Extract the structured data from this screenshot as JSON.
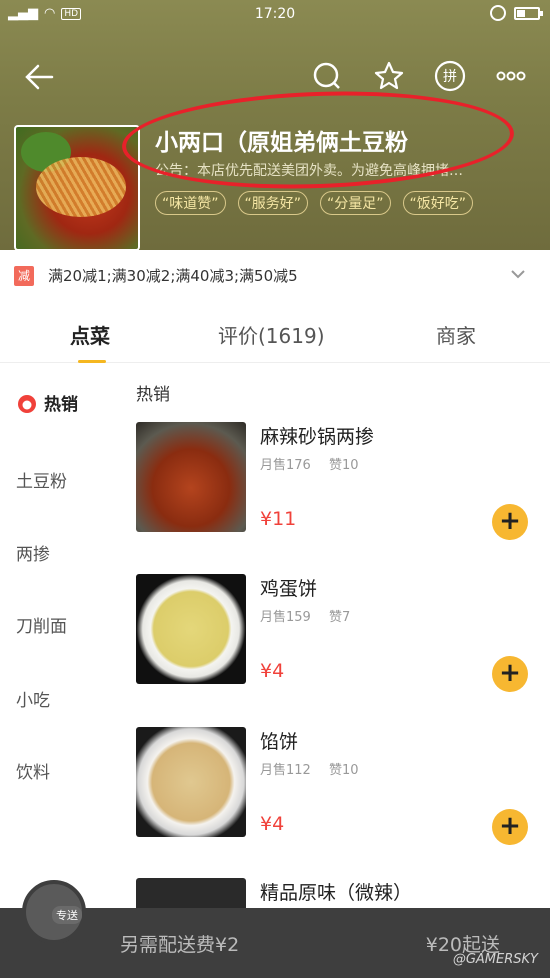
{
  "status_bar": {
    "signal": "all",
    "hd": "HD",
    "time": "17:20"
  },
  "shop": {
    "title": "小两口（原姐弟俩土豆粉",
    "notice": "公告：本店优先配送美团外卖。为避免高峰拥堵…",
    "tags": [
      "“味道赞”",
      "“服务好”",
      "“分量足”",
      "“饭好吃”"
    ]
  },
  "promo": {
    "badge": "减",
    "text": "满20减1;满30减2;满40减3;满50减5"
  },
  "tabs": [
    {
      "label": "点菜"
    },
    {
      "label": "评价(1619)"
    },
    {
      "label": "商家"
    }
  ],
  "sidebar": {
    "items": [
      {
        "label": "热销"
      },
      {
        "label": "土豆粉"
      },
      {
        "label": "两掺"
      },
      {
        "label": "刀削面"
      },
      {
        "label": "小吃"
      },
      {
        "label": "饮料"
      }
    ]
  },
  "menu": {
    "section_title": "热销",
    "items": [
      {
        "name": "麻辣砂锅两掺",
        "sold": "月售176",
        "likes": "赞10",
        "price": "¥11"
      },
      {
        "name": "鸡蛋饼",
        "sold": "月售159",
        "likes": "赞7",
        "price": "¥4"
      },
      {
        "name": "馅饼",
        "sold": "月售112",
        "likes": "赞10",
        "price": "¥4"
      },
      {
        "name": "精品原味（微辣）"
      }
    ],
    "add_symbol": "+"
  },
  "bottom": {
    "cart_badge": "专送",
    "delivery_fee": "另需配送费¥2",
    "min_order": "¥20起送"
  },
  "watermark": "@GAMERSKY",
  "colors": {
    "accent": "#f7b731",
    "price": "#f0413a",
    "highlight_ring": "#e8212a",
    "header": "#7d7c47"
  }
}
